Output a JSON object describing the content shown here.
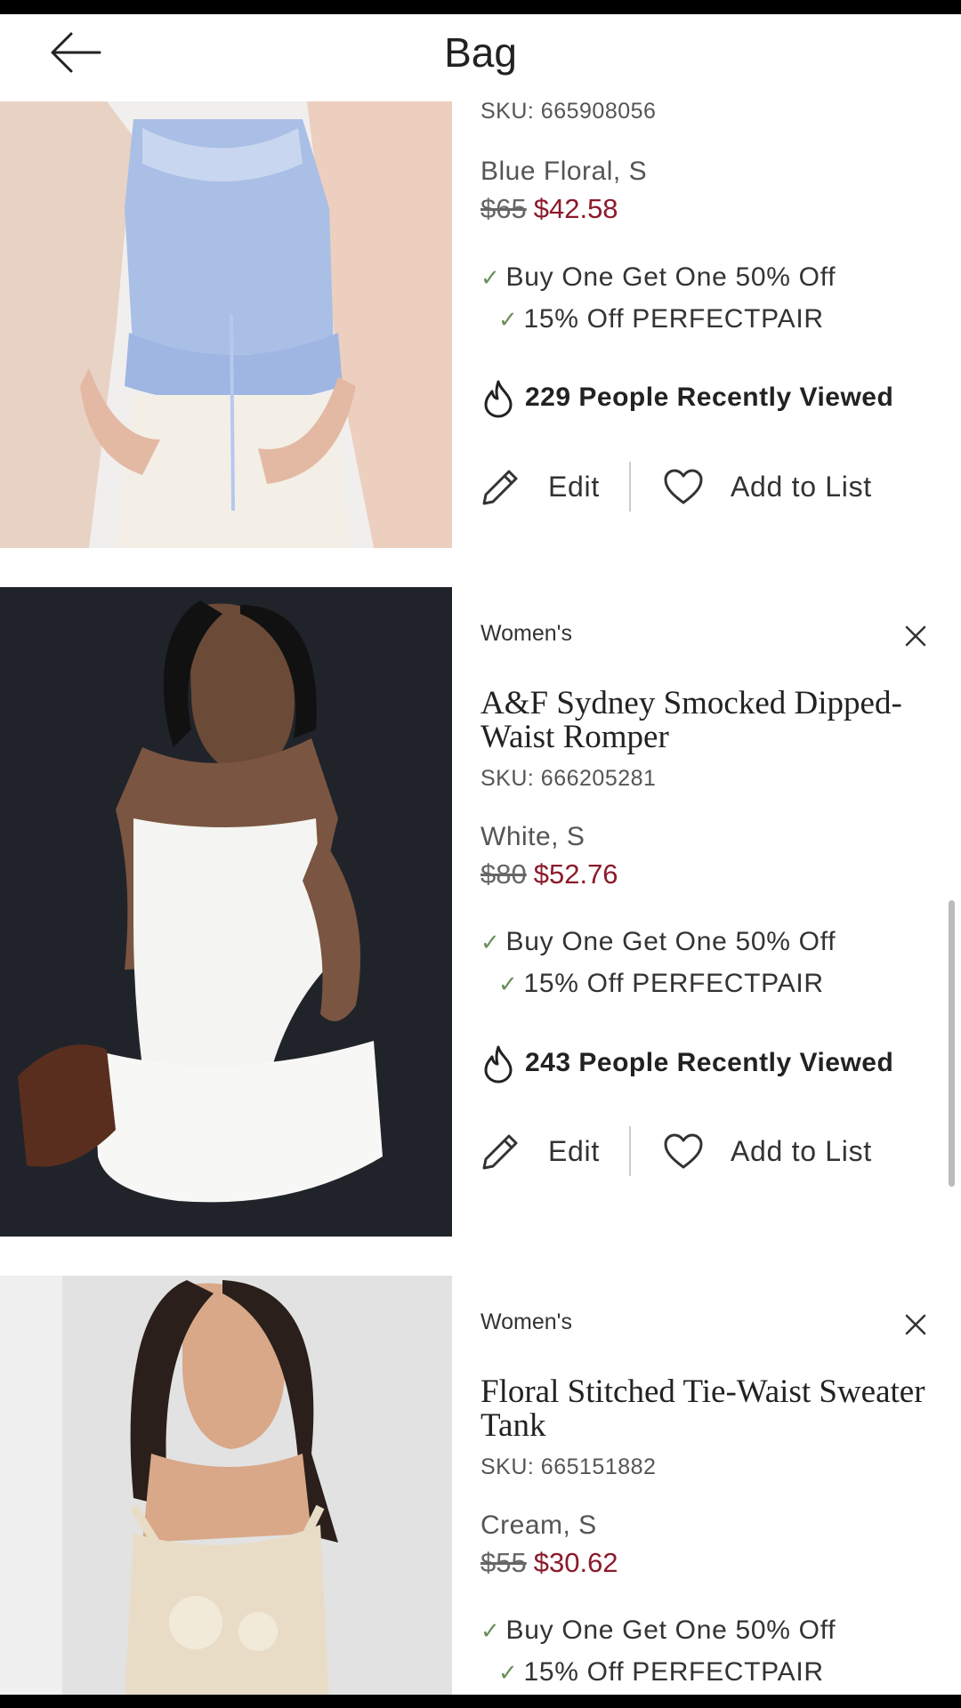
{
  "header": {
    "title": "Bag",
    "back_icon": "arrow-left-icon"
  },
  "colors": {
    "sale_price": "#8b1a2b",
    "check": "#6a8f5a"
  },
  "items": [
    {
      "category": "",
      "name": "",
      "sku": "SKU: 665908056",
      "color_size": "Blue Floral, S",
      "orig_price": "$65",
      "sale_price": "$42.58",
      "promo1": "Buy One Get One 50% Off",
      "promo2": "15% Off PERFECTPAIR",
      "viewed": "229 People Recently Viewed",
      "edit_label": "Edit",
      "list_label": "Add to List"
    },
    {
      "category": "Women's",
      "name": "A&F Sydney Smocked Dipped-Waist Romper",
      "sku": "SKU: 666205281",
      "color_size": "White, S",
      "orig_price": "$80",
      "sale_price": "$52.76",
      "promo1": "Buy One Get One 50% Off",
      "promo2": "15% Off PERFECTPAIR",
      "viewed": "243 People Recently Viewed",
      "edit_label": "Edit",
      "list_label": "Add to List"
    },
    {
      "category": "Women's",
      "name": "Floral Stitched Tie-Waist Sweater Tank",
      "sku": "SKU: 665151882",
      "color_size": "Cream, S",
      "orig_price": "$55",
      "sale_price": "$30.62",
      "promo1": "Buy One Get One 50% Off",
      "promo2": "15% Off PERFECTPAIR"
    }
  ]
}
